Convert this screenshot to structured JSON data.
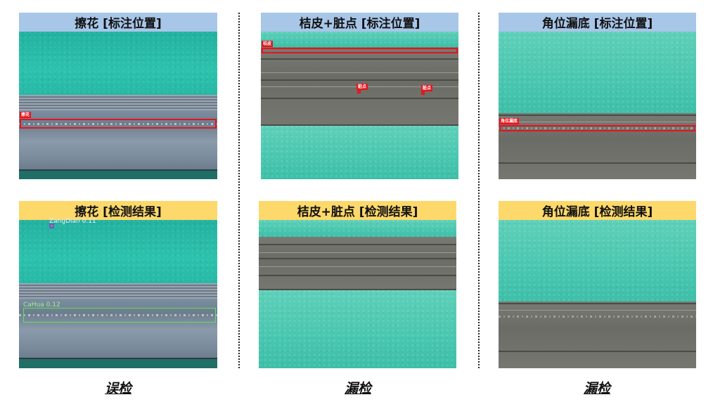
{
  "columns": [
    {
      "top_header": "擦花 [标注位置]",
      "top_labels": [
        "擦花"
      ],
      "bottom_header": "擦花 [检测结果]",
      "bottom_labels": [
        "ZangDian 0.11",
        "CaHua 0.12"
      ],
      "caption": "误检"
    },
    {
      "top_header": "桔皮+脏点 [标注位置]",
      "top_labels": [
        "桔皮",
        "脏点",
        "脏点"
      ],
      "bottom_header": "桔皮+脏点 [检测结果]",
      "bottom_labels": [],
      "caption": "漏检"
    },
    {
      "top_header": "角位漏底 [标注位置]",
      "top_labels": [
        "角位漏底"
      ],
      "bottom_header": "角位漏底 [检测结果]",
      "bottom_labels": [],
      "caption": "漏检"
    }
  ],
  "colors": {
    "annotation_header": "#a8c6e8",
    "detection_header": "#fdd86a",
    "annotation_box": "#e5141c",
    "detection_box": "#5fe05a",
    "secondary_detection_box": "#8a4fb8"
  }
}
